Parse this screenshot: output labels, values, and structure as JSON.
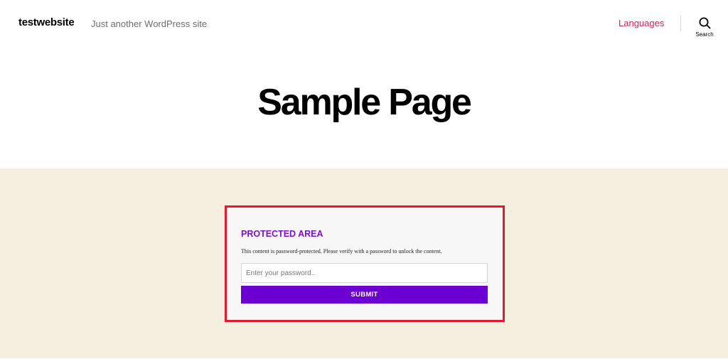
{
  "header": {
    "site_title": "testwebsite",
    "site_description": "Just another WordPress site",
    "nav": {
      "languages_label": "Languages"
    },
    "search": {
      "icon": "search-icon",
      "label": "Search"
    }
  },
  "hero": {
    "page_title": "Sample Page"
  },
  "protected_area": {
    "heading": "PROTECTED AREA",
    "message": "This content is password-protected. Please verify with a password to unlock the content.",
    "password_placeholder": "Enter your password..",
    "submit_label": "SUBMIT"
  },
  "colors": {
    "accent_link": "#cd2653",
    "heading_purple": "#7a12c9",
    "submit_purple": "#6c00d2",
    "highlight_border": "#e21b2a",
    "content_background": "#f5efe0"
  }
}
